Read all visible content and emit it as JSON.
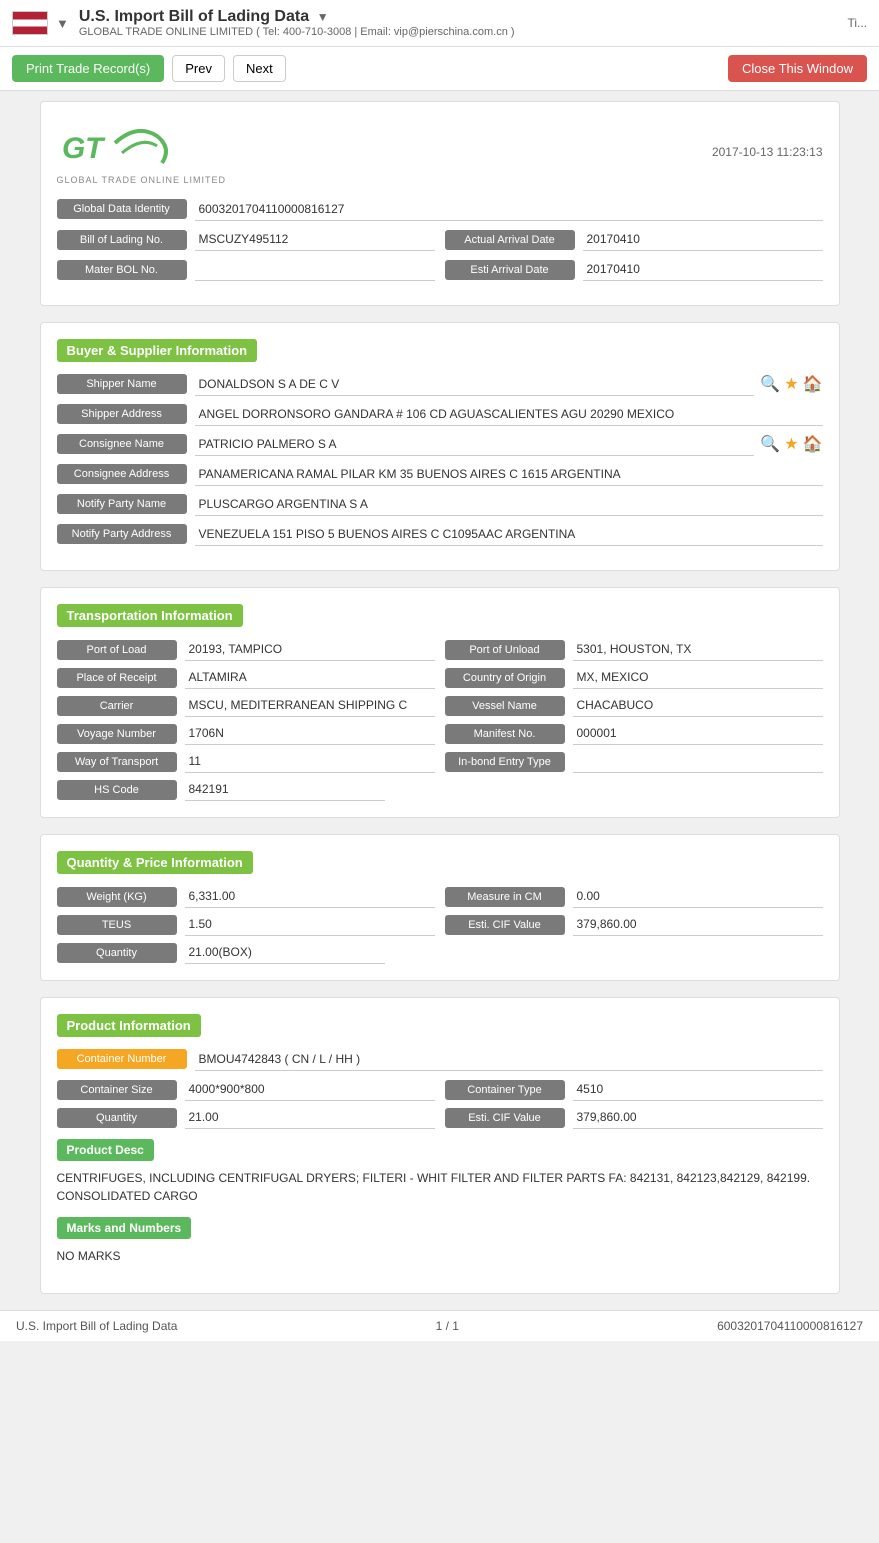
{
  "topbar": {
    "title": "U.S. Import Bill of Lading Data",
    "subtitle": "GLOBAL TRADE ONLINE LIMITED ( Tel: 400-710-3008 | Email: vip@pierschina.com.cn )",
    "right_text": "Ti..."
  },
  "toolbar": {
    "print_label": "Print Trade Record(s)",
    "prev_label": "Prev",
    "next_label": "Next",
    "close_label": "Close This Window"
  },
  "logo": {
    "text": "GTC",
    "company": "GLOBAL TRADE ONLINE LIMITED",
    "timestamp": "2017-10-13 11:23:13"
  },
  "identity": {
    "global_data_label": "Global Data Identity",
    "global_data_value": "6003201704110000816127",
    "bol_label": "Bill of Lading No.",
    "bol_value": "MSCUZY495112",
    "actual_arrival_label": "Actual Arrival Date",
    "actual_arrival_value": "20170410",
    "mater_bol_label": "Mater BOL No.",
    "mater_bol_value": "",
    "esti_arrival_label": "Esti Arrival Date",
    "esti_arrival_value": "20170410"
  },
  "buyer_supplier": {
    "section_title": "Buyer & Supplier Information",
    "shipper_name_label": "Shipper Name",
    "shipper_name_value": "DONALDSON S A DE C V",
    "shipper_address_label": "Shipper Address",
    "shipper_address_value": "ANGEL DORRONSORO GANDARA # 106 CD AGUASCALIENTES AGU 20290 MEXICO",
    "consignee_name_label": "Consignee Name",
    "consignee_name_value": "PATRICIO PALMERO S A",
    "consignee_address_label": "Consignee Address",
    "consignee_address_value": "PANAMERICANA RAMAL PILAR KM 35 BUENOS AIRES C 1615 ARGENTINA",
    "notify_party_name_label": "Notify Party Name",
    "notify_party_name_value": "PLUSCARGO ARGENTINA S A",
    "notify_party_address_label": "Notify Party Address",
    "notify_party_address_value": "VENEZUELA 151 PISO 5 BUENOS AIRES C C1095AAC ARGENTINA"
  },
  "transportation": {
    "section_title": "Transportation Information",
    "port_of_load_label": "Port of Load",
    "port_of_load_value": "20193, TAMPICO",
    "port_of_unload_label": "Port of Unload",
    "port_of_unload_value": "5301, HOUSTON, TX",
    "place_of_receipt_label": "Place of Receipt",
    "place_of_receipt_value": "ALTAMIRA",
    "country_of_origin_label": "Country of Origin",
    "country_of_origin_value": "MX, MEXICO",
    "carrier_label": "Carrier",
    "carrier_value": "MSCU, MEDITERRANEAN SHIPPING C",
    "vessel_name_label": "Vessel Name",
    "vessel_name_value": "CHACABUCO",
    "voyage_number_label": "Voyage Number",
    "voyage_number_value": "1706N",
    "manifest_no_label": "Manifest No.",
    "manifest_no_value": "000001",
    "way_of_transport_label": "Way of Transport",
    "way_of_transport_value": "11",
    "inbond_entry_label": "In-bond Entry Type",
    "inbond_entry_value": "",
    "hs_code_label": "HS Code",
    "hs_code_value": "842191"
  },
  "quantity_price": {
    "section_title": "Quantity & Price Information",
    "weight_label": "Weight (KG)",
    "weight_value": "6,331.00",
    "measure_label": "Measure in CM",
    "measure_value": "0.00",
    "teus_label": "TEUS",
    "teus_value": "1.50",
    "esti_cif_label": "Esti. CIF Value",
    "esti_cif_value": "379,860.00",
    "quantity_label": "Quantity",
    "quantity_value": "21.00(BOX)"
  },
  "product": {
    "section_title": "Product Information",
    "container_number_label": "Container Number",
    "container_number_value": "BMOU4742843 ( CN / L / HH )",
    "container_size_label": "Container Size",
    "container_size_value": "4000*900*800",
    "container_type_label": "Container Type",
    "container_type_value": "4510",
    "quantity_label": "Quantity",
    "quantity_value": "21.00",
    "esti_cif_label": "Esti. CIF Value",
    "esti_cif_value": "379,860.00",
    "product_desc_label": "Product Desc",
    "product_desc_text": "CENTRIFUGES, INCLUDING CENTRIFUGAL DRYERS; FILTERI - WHIT FILTER AND FILTER PARTS FA: 842131, 842123,842129, 842199.\nCONSOLIDATED CARGO",
    "marks_label": "Marks and Numbers",
    "marks_value": "NO MARKS"
  },
  "footer": {
    "left": "U.S. Import Bill of Lading Data",
    "center": "1 / 1",
    "right": "6003201704110000816127"
  }
}
